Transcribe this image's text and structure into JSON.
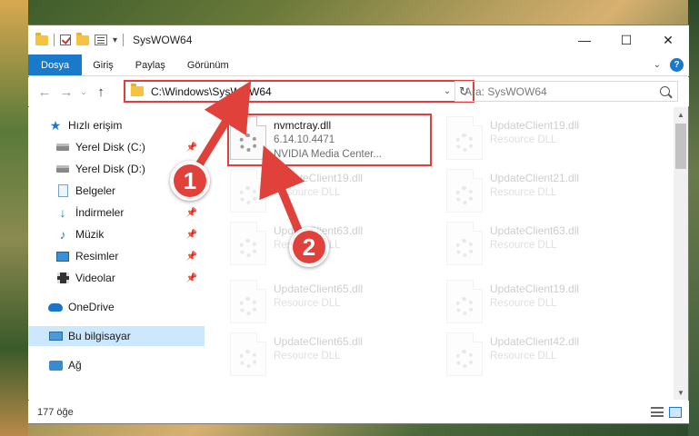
{
  "window": {
    "title": "SysWOW64"
  },
  "controls": {
    "minimize": "—",
    "maximize": "☐",
    "close": "✕"
  },
  "ribbon": {
    "tabs": [
      "Dosya",
      "Giriş",
      "Paylaş",
      "Görünüm"
    ]
  },
  "address": {
    "path": "C:\\Windows\\SysWOW64",
    "search_placeholder": "Ara: SysWOW64"
  },
  "sidebar": {
    "items": [
      {
        "label": "Hızlı erişim",
        "icon": "star-icon"
      },
      {
        "label": "Yerel Disk (C:)",
        "icon": "disk-icon",
        "pinned": true
      },
      {
        "label": "Yerel Disk (D:)",
        "icon": "disk-icon",
        "pinned": false
      },
      {
        "label": "Belgeler",
        "icon": "document-icon",
        "pinned": true
      },
      {
        "label": "İndirmeler",
        "icon": "download-icon",
        "pinned": true
      },
      {
        "label": "Müzik",
        "icon": "music-icon",
        "pinned": true
      },
      {
        "label": "Resimler",
        "icon": "pictures-icon",
        "pinned": true
      },
      {
        "label": "Videolar",
        "icon": "video-icon",
        "pinned": true
      },
      {
        "label": "OneDrive",
        "icon": "cloud-icon"
      },
      {
        "label": "Bu bilgisayar",
        "icon": "computer-icon",
        "selected": true
      },
      {
        "label": "Ağ",
        "icon": "network-icon"
      }
    ]
  },
  "files": {
    "highlighted": {
      "name": "nvmctray.dll",
      "version": "6.14.10.4471",
      "description": "NVIDIA Media Center..."
    },
    "left_column": [
      {
        "name": "UpdateClient19.dll",
        "type": "Resource DLL"
      },
      {
        "name": "UpdateClient63.dll",
        "type": "Resource DLL"
      },
      {
        "name": "UpdateClient65.dll",
        "type": "Resource DLL"
      },
      {
        "name": "UpdateClient65.dll",
        "type": "Resource DLL"
      }
    ],
    "right_column": [
      {
        "name": "UpdateClient19.dll",
        "type": "Resource DLL"
      },
      {
        "name": "UpdateClient21.dll",
        "type": "Resource DLL"
      },
      {
        "name": "UpdateClient63.dll",
        "type": "Resource DLL"
      },
      {
        "name": "UpdateClient19.dll",
        "type": "Resource DLL"
      },
      {
        "name": "UpdateClient42.dll",
        "type": "Resource DLL"
      }
    ]
  },
  "status": {
    "item_count": "177 öğe"
  },
  "annotations": {
    "badge_1": "1",
    "badge_2": "2",
    "accent_color": "#e0413b"
  }
}
